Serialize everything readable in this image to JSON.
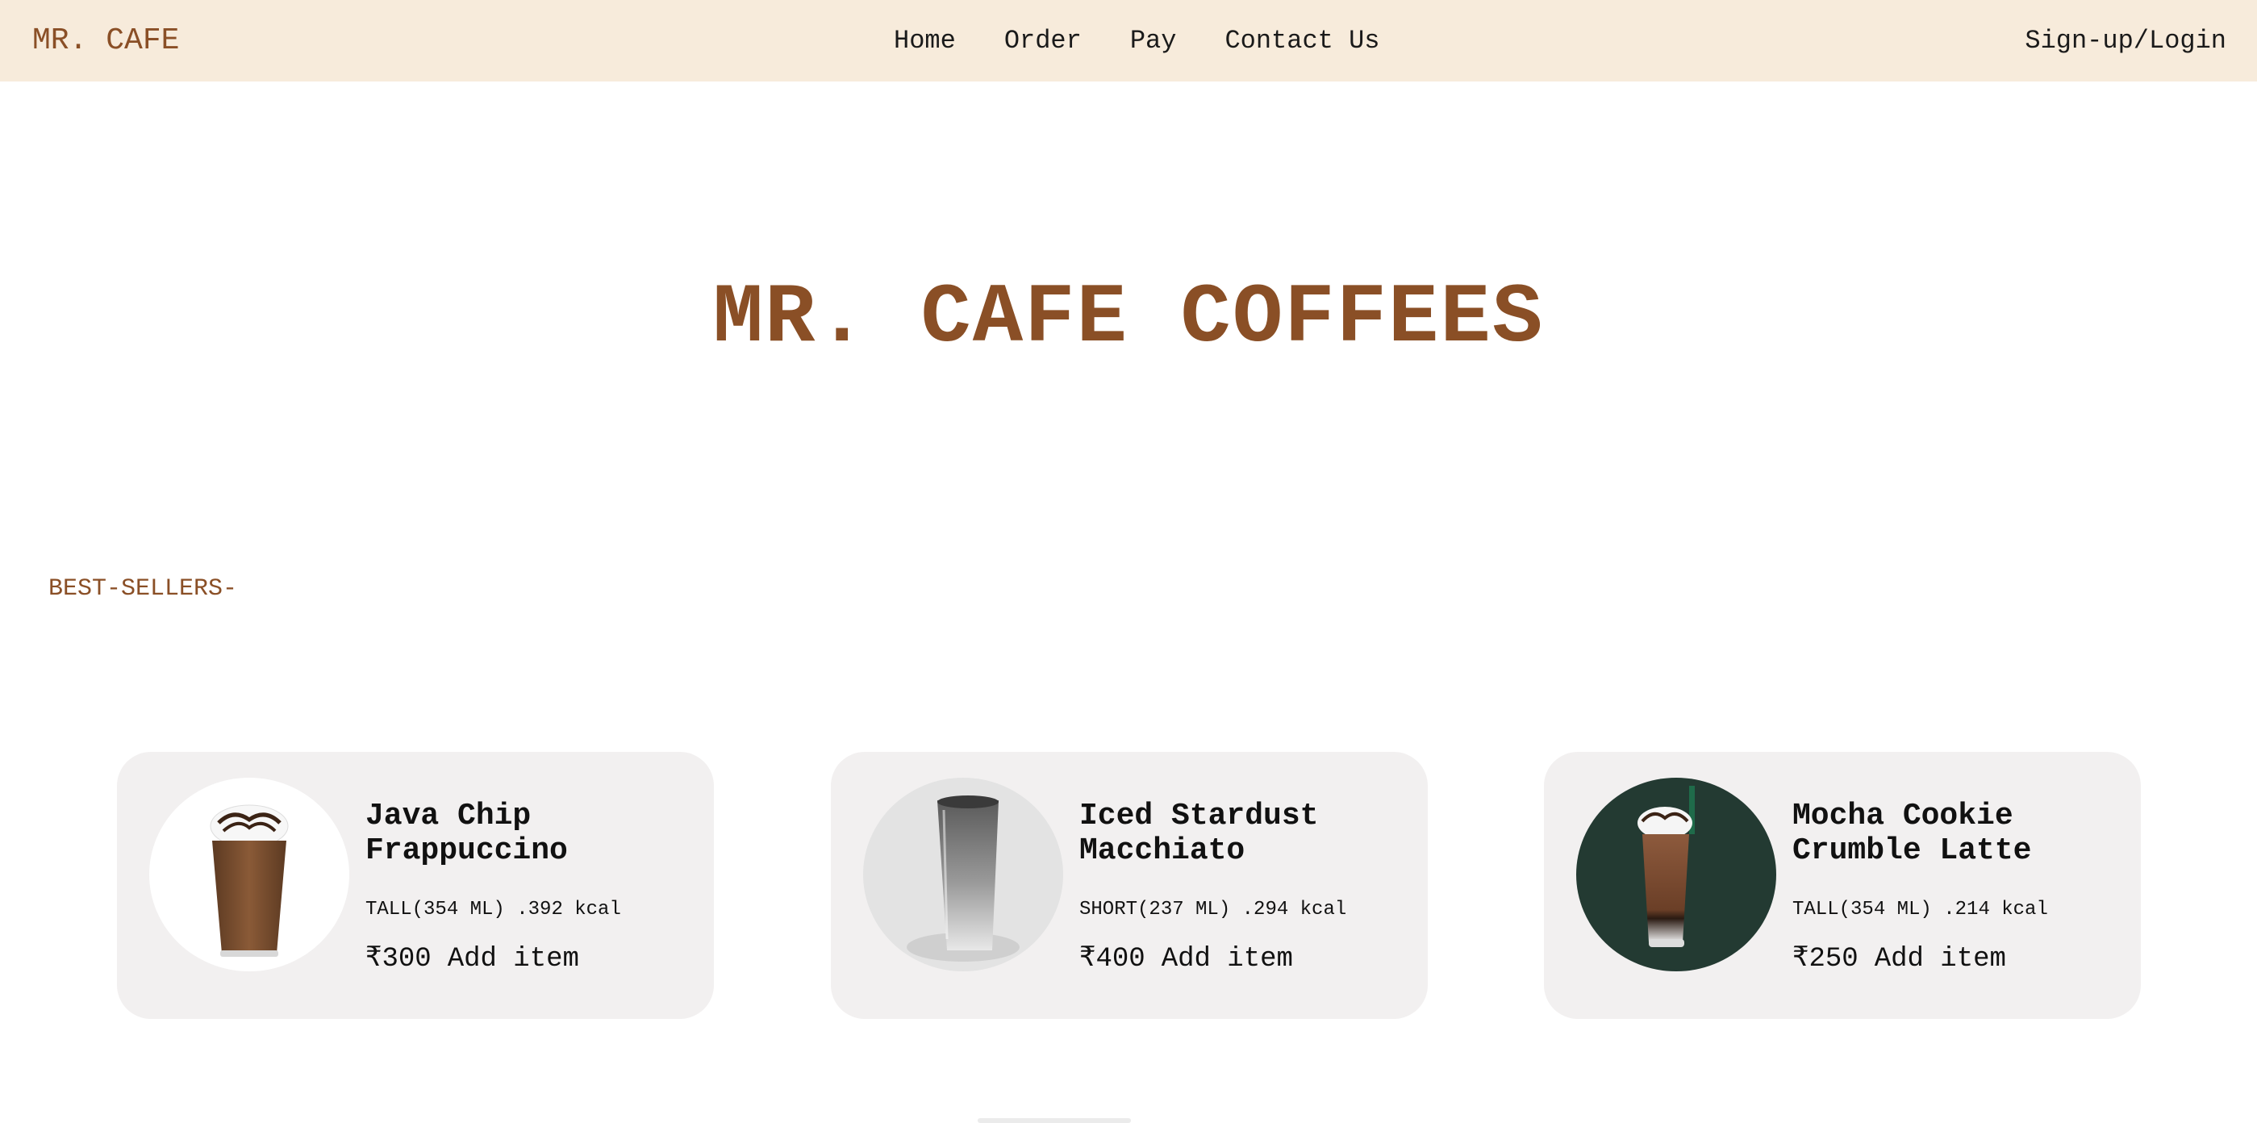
{
  "nav": {
    "brand": "MR. CAFE",
    "links": [
      "Home",
      "Order",
      "Pay",
      "Contact Us"
    ],
    "login": "Sign-up/Login"
  },
  "hero": {
    "title": "MR. CAFE COFFEES"
  },
  "best_sellers": {
    "label": "BEST-SELLERS-",
    "items": [
      {
        "name": "Java Chip Frappuccino",
        "size": "TALL(354 ML)",
        "kcal": ".392 kcal",
        "price": "₹300",
        "add_label": "Add item",
        "image_icon": "java-chip-frappuccino-image"
      },
      {
        "name": "Iced Stardust Macchiato",
        "size": "SHORT(237 ML)",
        "kcal": ".294 kcal",
        "price": "₹400",
        "add_label": "Add item",
        "image_icon": "iced-stardust-macchiato-image"
      },
      {
        "name": "Mocha Cookie Crumble Latte",
        "size": "TALL(354 ML)",
        "kcal": ".214 kcal",
        "price": "₹250",
        "add_label": "Add item",
        "image_icon": "mocha-cookie-crumble-latte-image"
      }
    ]
  },
  "colors": {
    "nav_bg": "#f7ebdb",
    "brand": "#8a4f26",
    "card_bg": "#f2f0f0"
  }
}
